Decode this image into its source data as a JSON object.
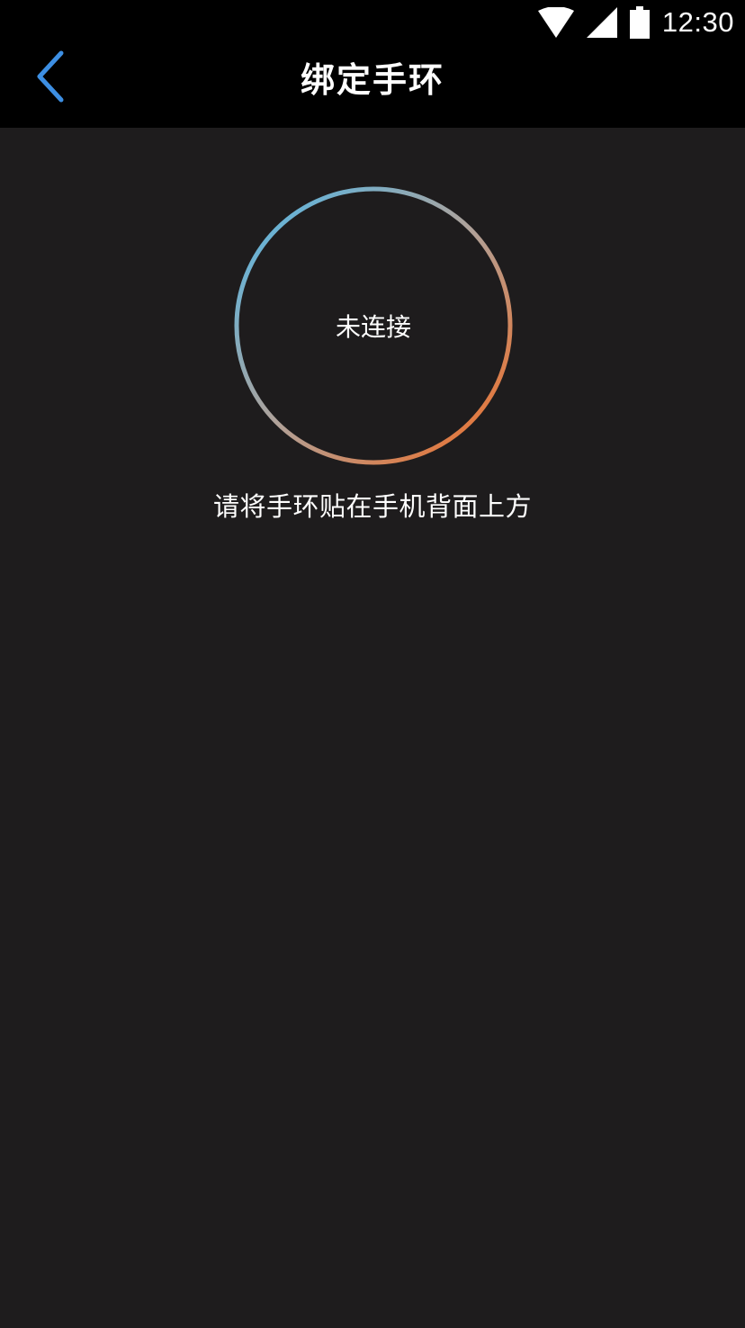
{
  "status_bar": {
    "time": "12:30",
    "icons": [
      "wifi-icon",
      "cell-signal-icon",
      "battery-icon"
    ]
  },
  "header": {
    "title": "绑定手环",
    "back_icon": "chevron-left-icon"
  },
  "main": {
    "ring_status": "未连接",
    "instruction": "请将手环贴在手机背面上方"
  },
  "colors": {
    "background": "#1e1c1d",
    "bar_background": "#000000",
    "ring_gradient_start": "#4fb8ea",
    "ring_gradient_end": "#f26b21",
    "back_icon": "#3d8fe3",
    "text": "#ffffff"
  }
}
